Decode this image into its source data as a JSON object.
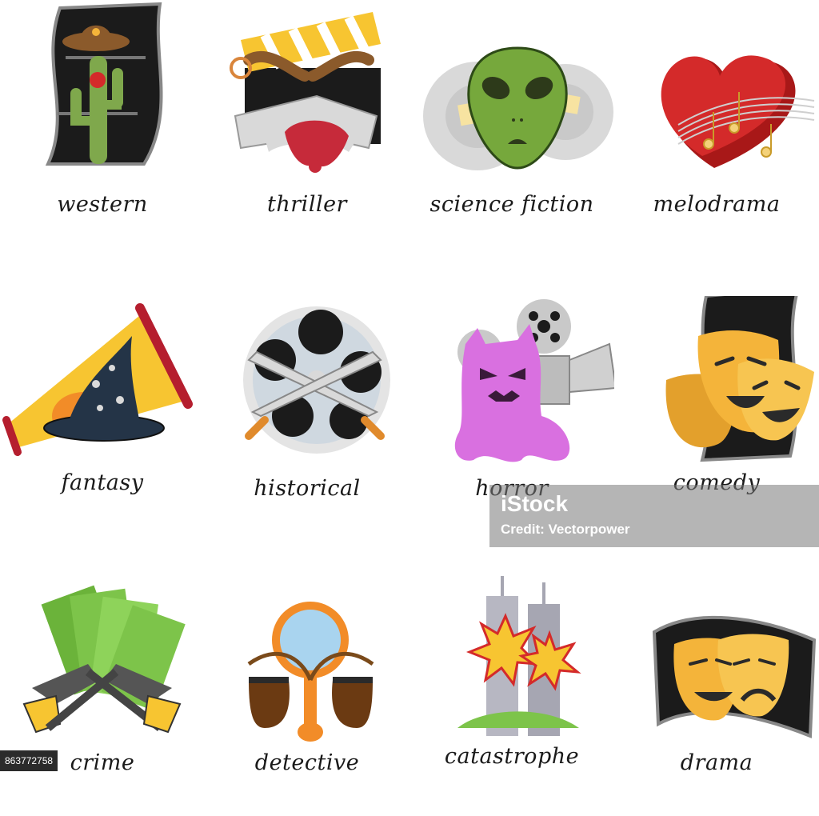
{
  "genres": [
    {
      "label": "western",
      "icon": "cactus-cowboy-hat-film-icon"
    },
    {
      "label": "thriller",
      "icon": "clapperboard-knives-icon"
    },
    {
      "label": "science fiction",
      "icon": "alien-head-icon"
    },
    {
      "label": "melodrama",
      "icon": "heart-music-notes-icon"
    },
    {
      "label": "fantasy",
      "icon": "megaphone-wizard-hat-icon"
    },
    {
      "label": "historical",
      "icon": "film-reel-crossed-swords-icon"
    },
    {
      "label": "horror",
      "icon": "ghost-projector-icon"
    },
    {
      "label": "comedy",
      "icon": "comedy-masks-film-icon"
    },
    {
      "label": "crime",
      "icon": "money-crossed-revolvers-icon"
    },
    {
      "label": "detective",
      "icon": "magnifier-pipes-icon"
    },
    {
      "label": "catastrophe",
      "icon": "towers-explosion-icon"
    },
    {
      "label": "drama",
      "icon": "drama-masks-film-icon"
    }
  ],
  "watermark": {
    "brand": "iStock",
    "credit": "Credit: Vectorpower"
  },
  "stock_id": "863772758",
  "colors": {
    "film_strip": "#1b1b1b",
    "gold_mask": "#f4b43a",
    "alien_green": "#76a83c",
    "heart_red": "#d42a2a",
    "ghost_purple": "#d970e0",
    "money_green": "#7dc44a",
    "megaphone_yellow": "#f7c531",
    "fire_orange": "#f28c28"
  }
}
